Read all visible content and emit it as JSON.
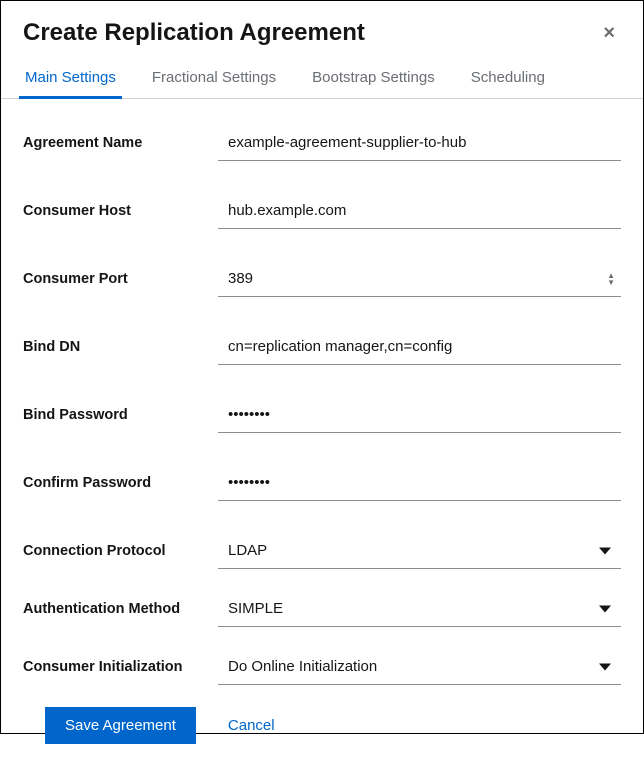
{
  "dialog": {
    "title": "Create Replication Agreement"
  },
  "tabs": {
    "main": "Main Settings",
    "fractional": "Fractional Settings",
    "bootstrap": "Bootstrap Settings",
    "scheduling": "Scheduling"
  },
  "form": {
    "agreement_name": {
      "label": "Agreement Name",
      "value": "example-agreement-supplier-to-hub"
    },
    "consumer_host": {
      "label": "Consumer Host",
      "value": "hub.example.com"
    },
    "consumer_port": {
      "label": "Consumer Port",
      "value": "389"
    },
    "bind_dn": {
      "label": "Bind DN",
      "value": "cn=replication manager,cn=config"
    },
    "bind_password": {
      "label": "Bind Password",
      "value": "••••••••"
    },
    "confirm_password": {
      "label": "Confirm Password",
      "value": "••••••••"
    },
    "connection_protocol": {
      "label": "Connection Protocol",
      "value": "LDAP"
    },
    "authentication_method": {
      "label": "Authentication Method",
      "value": "SIMPLE"
    },
    "consumer_initialization": {
      "label": "Consumer Initialization",
      "value": "Do Online Initialization"
    }
  },
  "footer": {
    "save": "Save Agreement",
    "cancel": "Cancel"
  }
}
